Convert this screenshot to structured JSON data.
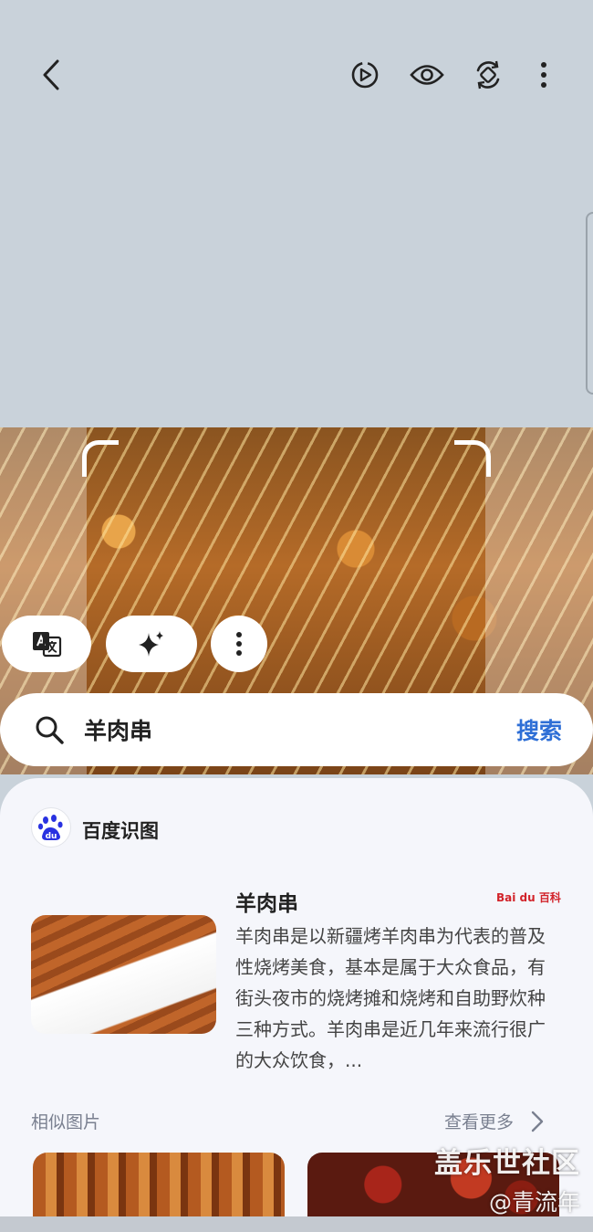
{
  "search": {
    "query": "羊肉串",
    "action_label": "搜索"
  },
  "source": {
    "name": "百度识图",
    "logo_text": "du"
  },
  "result": {
    "title": "羊肉串",
    "provider_logo_text": "Bai du 百科",
    "description": "羊肉串是以新疆烤羊肉串为代表的普及性烧烤美食，基本是属于大众食品，有街头夜市的烧烤摊和烧烤和自助野炊种三种方式。羊肉串是近几年来流行很广的大众饮食，..."
  },
  "similar": {
    "label": "相似图片",
    "more_label": "查看更多"
  },
  "watermark": {
    "line1": "盖乐世社区",
    "line2": "@青流年"
  },
  "colors": {
    "background": "#c9d2da",
    "accent": "#2f6fd6",
    "card": "#f5f6fb"
  },
  "icons": [
    "back-icon",
    "motion-photo-icon",
    "eye-icon",
    "rotate-icon",
    "more-vert-icon",
    "translate-icon",
    "sparkle-icon",
    "search-icon",
    "chevron-right-icon"
  ]
}
